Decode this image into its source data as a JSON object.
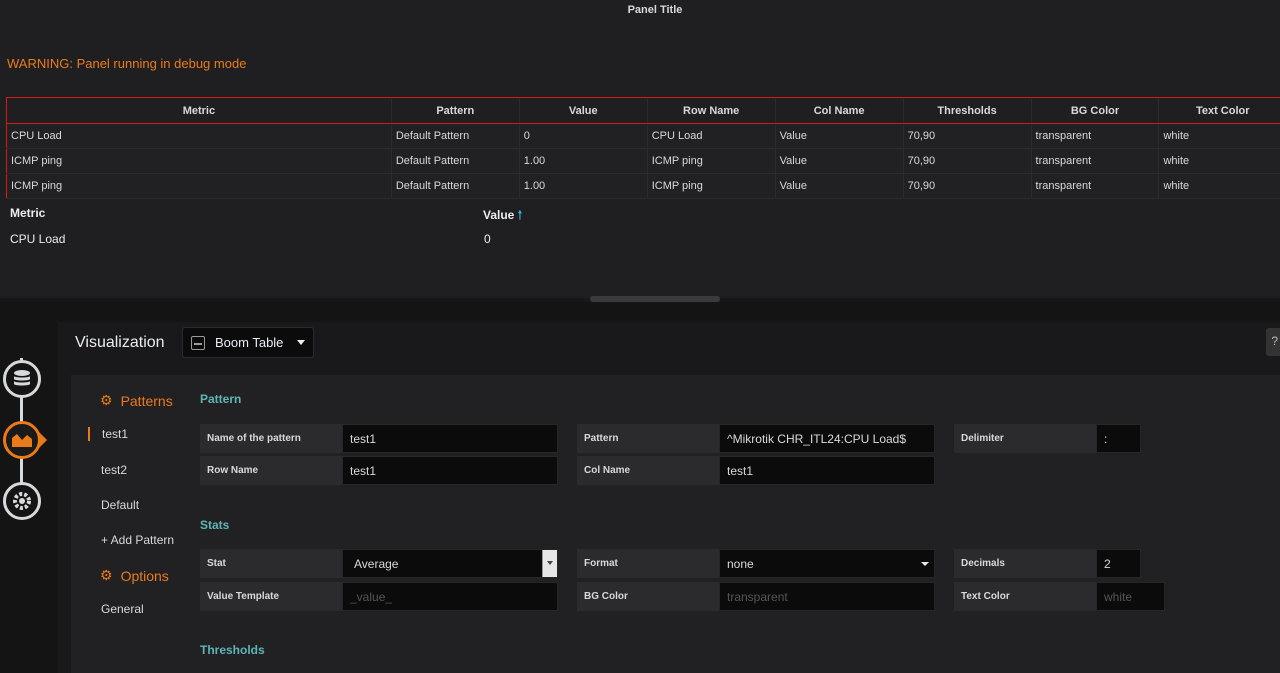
{
  "panel": {
    "title": "Panel Title",
    "warning": "WARNING: Panel running in debug mode"
  },
  "debug_table": {
    "headers": [
      "Metric",
      "Pattern",
      "Value",
      "Row Name",
      "Col Name",
      "Thresholds",
      "BG Color",
      "Text Color"
    ],
    "rows": [
      [
        "CPU Load",
        "Default Pattern",
        "0",
        "CPU Load",
        "Value",
        "70,90",
        "transparent",
        "white"
      ],
      [
        "ICMP ping",
        "Default Pattern",
        "1.00",
        "ICMP ping",
        "Value",
        "70,90",
        "transparent",
        "white"
      ],
      [
        "ICMP ping",
        "Default Pattern",
        "1.00",
        "ICMP ping",
        "Value",
        "70,90",
        "transparent",
        "white"
      ]
    ]
  },
  "rendered_table": {
    "headers": [
      "Metric",
      "Value"
    ],
    "sort_icon": "arrow-up-icon",
    "rows": [
      [
        "CPU Load",
        "0"
      ]
    ]
  },
  "editor": {
    "viz_title": "Visualization",
    "viz_name": "Boom Table",
    "help": "?",
    "rail_icons": [
      "database-icon",
      "chart-icon",
      "settings-icon"
    ]
  },
  "nav": {
    "patterns_label": "Patterns",
    "items": [
      "test1",
      "test2",
      "Default"
    ],
    "add_pattern": "+ Add Pattern",
    "options_label": "Options",
    "general": "General"
  },
  "pattern_section": {
    "title": "Pattern",
    "name_label": "Name of the pattern",
    "name_value": "test1",
    "pattern_label": "Pattern",
    "pattern_value": "^Mikrotik CHR_ITL24:CPU Load$",
    "delimiter_label": "Delimiter",
    "delimiter_value": ":",
    "row_name_label": "Row Name",
    "row_name_value": "test1",
    "col_name_label": "Col Name",
    "col_name_value": "test1"
  },
  "stats_section": {
    "title": "Stats",
    "stat_label": "Stat",
    "stat_value": "Average",
    "format_label": "Format",
    "format_value": "none",
    "decimals_label": "Decimals",
    "decimals_value": "2",
    "value_template_label": "Value Template",
    "value_template_placeholder": "_value_",
    "bg_color_label": "BG Color",
    "bg_color_placeholder": "transparent",
    "text_color_label": "Text Color",
    "text_color_placeholder": "white"
  },
  "thresholds_section": {
    "title": "Thresholds"
  },
  "colors": {
    "accent": "#eb7b18",
    "section_title": "#5fb5b5",
    "debug_border": "#d01c1c"
  }
}
